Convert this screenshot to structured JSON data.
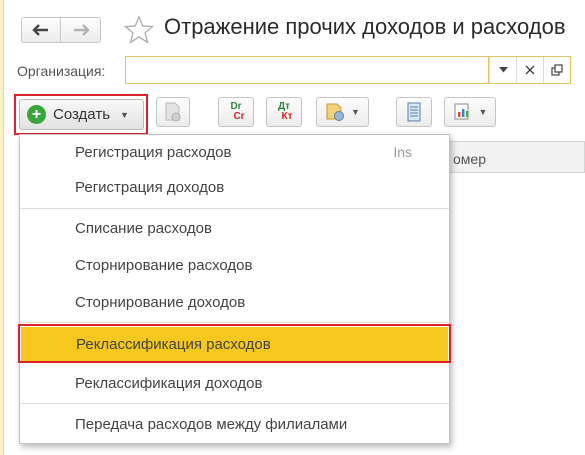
{
  "header": {
    "title": "Отражение прочих доходов и расходов"
  },
  "organization": {
    "label": "Организация:",
    "value": "",
    "placeholder": ""
  },
  "toolbar": {
    "create_label": "Создать",
    "btn_dt_top": "Dr",
    "btn_dt_bottom": "Cr",
    "btn_dtkt_top": "Дт",
    "btn_dtkt_bottom": "Кт"
  },
  "grid": {
    "column_partial": "омер"
  },
  "menu": {
    "items": [
      {
        "label": "Регистрация расходов",
        "shortcut": "Ins"
      },
      {
        "label": "Регистрация доходов"
      },
      {
        "label": "Списание расходов"
      },
      {
        "label": "Сторнирование расходов"
      },
      {
        "label": "Сторнирование доходов"
      },
      {
        "label": "Реклассификация расходов",
        "selected": true
      },
      {
        "label": "Реклассификация доходов"
      },
      {
        "label": "Передача расходов между филиалами"
      }
    ]
  },
  "colors": {
    "highlight_border": "#d9232a",
    "selected_item": "#f6c81e",
    "create_icon": "#3aa53c",
    "field_border": "#e3c36a"
  }
}
